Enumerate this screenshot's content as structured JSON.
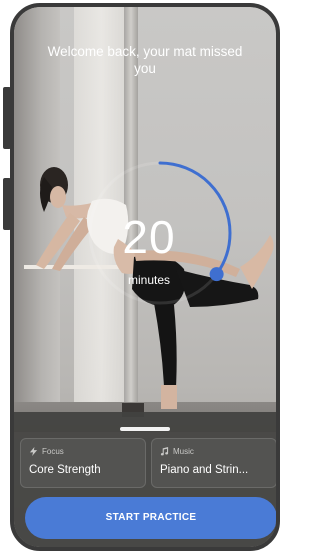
{
  "header": {
    "greeting": "Welcome back, your mat missed you"
  },
  "timer": {
    "value": "20",
    "unit": "minutes",
    "progress": 0.35
  },
  "options": {
    "focus": {
      "caption": "Focus",
      "value": "Core Strength",
      "icon": "lightning-icon"
    },
    "music": {
      "caption": "Music",
      "value": "Piano and Strin...",
      "icon": "music-note-icon"
    }
  },
  "actions": {
    "start_label": "START PRACTICE"
  },
  "colors": {
    "accent": "#4a7bd6",
    "sheet": "#424240",
    "card": "#535351"
  }
}
